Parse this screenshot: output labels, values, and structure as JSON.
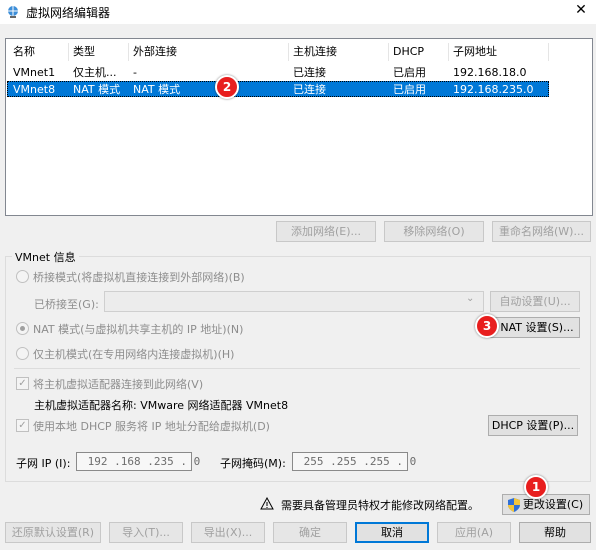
{
  "window": {
    "title": "虚拟网络编辑器",
    "close_label": "✕"
  },
  "table": {
    "headers": [
      "名称",
      "类型",
      "外部连接",
      "主机连接",
      "DHCP",
      "子网地址"
    ],
    "rows": [
      [
        "VMnet1",
        "仅主机...",
        "-",
        "已连接",
        "已启用",
        "192.168.18.0"
      ],
      [
        "VMnet8",
        "NAT 模式",
        "NAT 模式",
        "已连接",
        "已启用",
        "192.168.235.0"
      ]
    ],
    "selected_index": 1
  },
  "net_buttons": {
    "add": "添加网络(E)...",
    "remove": "移除网络(O)",
    "rename": "重命名网络(W)..."
  },
  "vmnet_info": {
    "group_label": "VMnet 信息",
    "bridge_label": "桥接模式(将虚拟机直接连接到外部网络)(B)",
    "bridged_to_label": "已桥接至(G):",
    "bridged_to_value": "",
    "auto_settings": "自动设置(U)...",
    "nat_label": "NAT 模式(与虚拟机共享主机的 IP 地址)(N)",
    "nat_settings": "NAT 设置(S)...",
    "hostonly_label": "仅主机模式(在专用网络内连接虚拟机)(H)",
    "connect_adapter_label": "将主机虚拟适配器连接到此网络(V)",
    "adapter_name_label": "主机虚拟适配器名称: VMware 网络适配器 VMnet8",
    "dhcp_label": "使用本地 DHCP 服务将 IP 地址分配给虚拟机(D)",
    "dhcp_settings": "DHCP 设置(P)...",
    "subnet_ip_label": "子网 IP (I):",
    "subnet_ip_value": " 192 .168 .235 . 0",
    "mask_label": "子网掩码(M):",
    "mask_value": " 255 .255 .255 . 0"
  },
  "admin": {
    "warning": "需要具备管理员特权才能修改网络配置。",
    "change_settings": "更改设置(C)"
  },
  "footer": {
    "restore": "还原默认设置(R)",
    "import": "导入(T)...",
    "export": "导出(X)...",
    "ok": "确定",
    "cancel": "取消",
    "apply": "应用(A)",
    "help": "帮助"
  },
  "badges": {
    "one": "1",
    "two": "2",
    "three": "3"
  },
  "colors": {
    "selection": "#0078d7",
    "badge": "#e81e1e"
  }
}
